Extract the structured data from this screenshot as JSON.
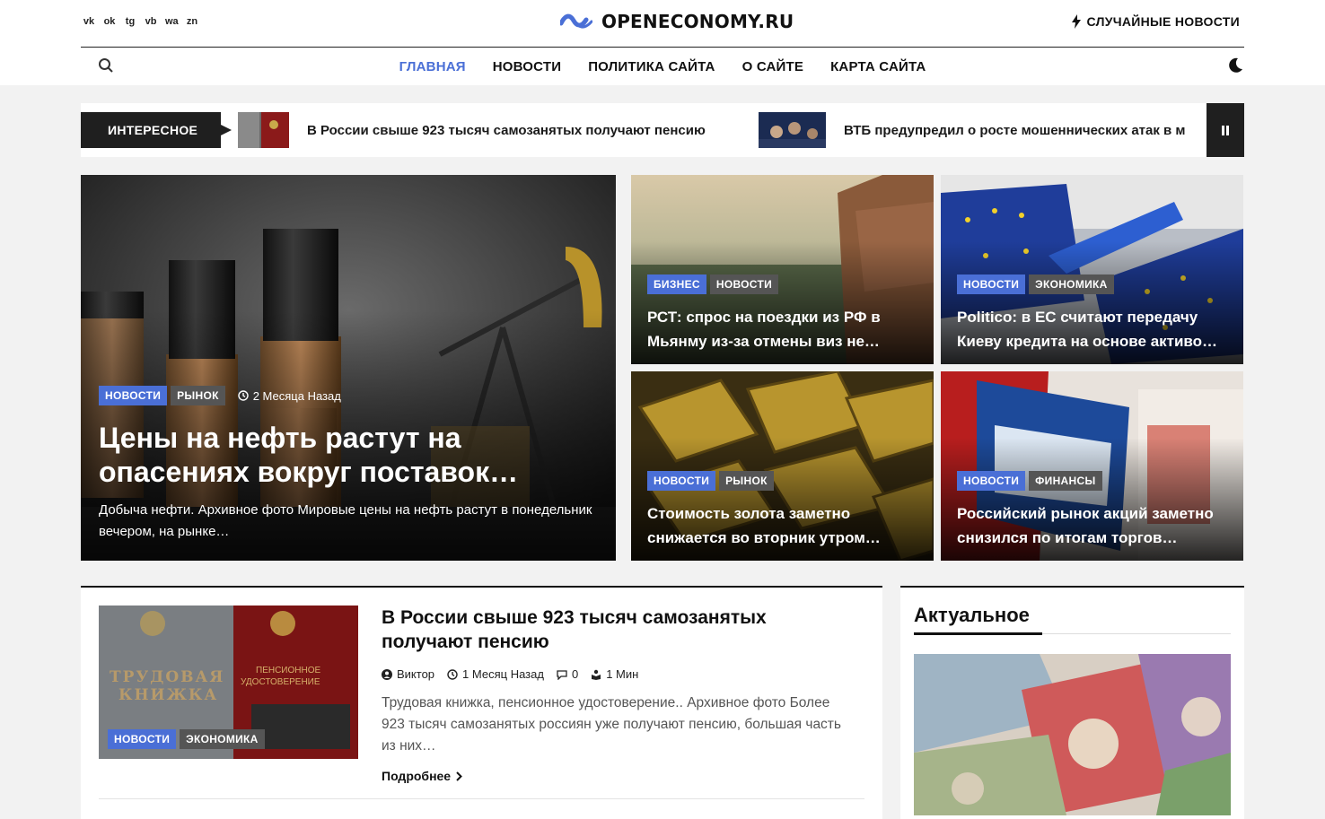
{
  "header": {
    "social_icons": [
      "vk-icon",
      "odnoklassniki-icon",
      "telegram-icon",
      "viber-icon",
      "whatsapp-icon",
      "yandex-zen-icon"
    ],
    "social_glyphs": [
      "vk",
      "ok",
      "tg",
      "vb",
      "wa",
      "zn"
    ],
    "logo_text": "OPENECONOMY.RU",
    "random_news": "СЛУЧАЙНЫЕ НОВОСТИ"
  },
  "nav": {
    "items": [
      "ГЛАВНАЯ",
      "НОВОСТИ",
      "ПОЛИТИКА САЙТА",
      "О САЙТЕ",
      "КАРТА САЙТА"
    ],
    "active_index": 0
  },
  "ticker": {
    "label": "ИНТЕРЕСНОЕ",
    "items": [
      "В России свыше 923 тысяч самозанятых получают пенсию",
      "ВТБ предупредил о росте мошеннических атак в м"
    ]
  },
  "featured": {
    "main": {
      "tags": [
        "НОВОСТИ",
        "РЫНОК"
      ],
      "time": "2 Месяца Назад",
      "title": "Цены на нефть растут на опасениях вокруг поставок…",
      "excerpt": " Добыча нефти. Архивное фото Мировые цены на нефть растут в понедельник вечером, на рынке…"
    },
    "grid": [
      {
        "tags": [
          "БИЗНЕС",
          "НОВОСТИ"
        ],
        "title": "РСТ: спрос на поездки из РФ в Мьянму из-за отмены виз не…"
      },
      {
        "tags": [
          "НОВОСТИ",
          "ЭКОНОМИКА"
        ],
        "title": "Politico: в ЕС считают передачу Киеву кредита на основе активо…"
      },
      {
        "tags": [
          "НОВОСТИ",
          "РЫНОК"
        ],
        "title": "Стоимость золота заметно снижается во вторник утром…"
      },
      {
        "tags": [
          "НОВОСТИ",
          "ФИНАНСЫ"
        ],
        "title": "Российский рынок акций заметно снизился по итогам торгов…"
      }
    ]
  },
  "article": {
    "tags": [
      "НОВОСТИ",
      "ЭКОНОМИКА"
    ],
    "title": "В России свыше 923 тысяч самозанятых получают пенсию",
    "author": "Виктор",
    "time": "1 Месяц Назад",
    "comments": "0",
    "read_time": "1 Мин",
    "excerpt": "Трудовая книжка, пенсионное удостоверение.. Архивное фото Более 923 тысяч самозанятых россиян уже получают пенсию, большая часть из них…",
    "more": "Подробнее",
    "image_text": {
      "left1": "ТРУДОВАЯ",
      "left2": "КНИЖКА",
      "right1": "ПЕНСИОННОЕ",
      "right2": "УДОСТОВЕРЕНИЕ"
    }
  },
  "sidebar": {
    "title": "Актуальное"
  },
  "colors": {
    "accent": "#4a6fd6",
    "dark": "#1f1f1f"
  }
}
